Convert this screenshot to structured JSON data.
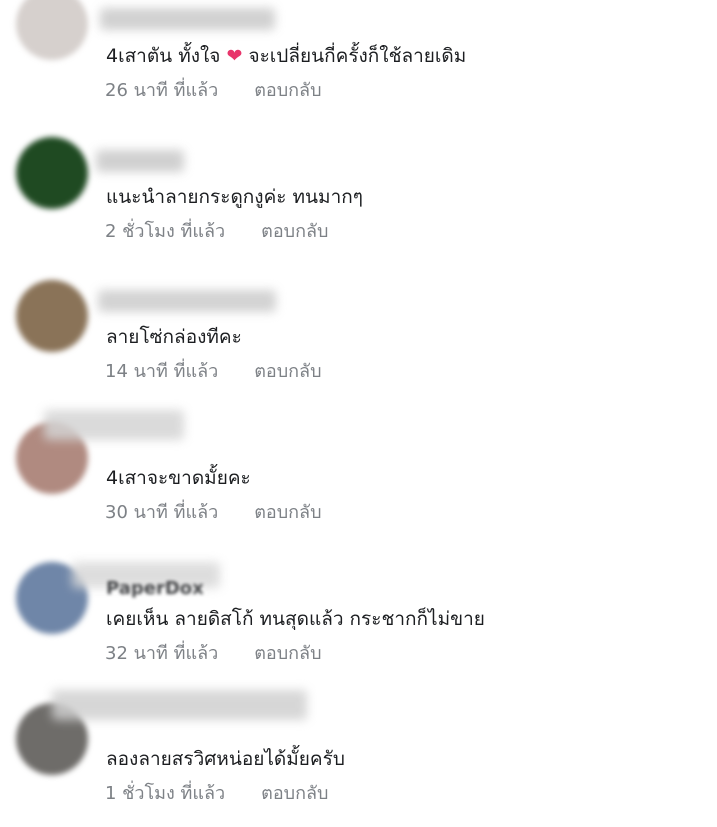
{
  "comments": [
    {
      "author_partial": "",
      "text": "4เสาตัน ทั้งใจ",
      "text_after_emoji": " จะเปลี่ยนกี่ครั้งก็ใช้ลายเดิม",
      "emoji": "heart-emoji",
      "time": "26 นาที ที่แล้ว",
      "reply": "ตอบกลับ",
      "avatar_color": "#cfc9c6"
    },
    {
      "author_partial": "",
      "text": "แนะนำลายกระดูกงูค่ะ ทนมากๆ",
      "time": "2 ชั่วโมง ที่แล้ว",
      "reply": "ตอบกลับ",
      "avatar_color": "#1f4a22"
    },
    {
      "author_partial": "",
      "text": "ลายโซ่กล่องทีคะ",
      "time": "14 นาที ที่แล้ว",
      "reply": "ตอบกลับ",
      "avatar_color": "#8a7358"
    },
    {
      "author_partial": "",
      "text": "4เสาจะขาดมั้ยคะ",
      "time": "30 นาที ที่แล้ว",
      "reply": "ตอบกลับ",
      "avatar_color": "#b08a80"
    },
    {
      "author_partial": "PaperDox",
      "text": "เคยเห็น ลายดิสโก้ ทนสุดแล้ว กระชากก็ไม่ขาย",
      "time": "32 นาที ที่แล้ว",
      "reply": "ตอบกลับ",
      "avatar_color": "#6f86a8"
    },
    {
      "author_partial": "",
      "text": "ลองลายสรวิศหน่อยได้มั้ยครับ",
      "time": "1 ชั่วโมง ที่แล้ว",
      "reply": "ตอบกลับ",
      "avatar_color": "#6e6c69"
    }
  ]
}
